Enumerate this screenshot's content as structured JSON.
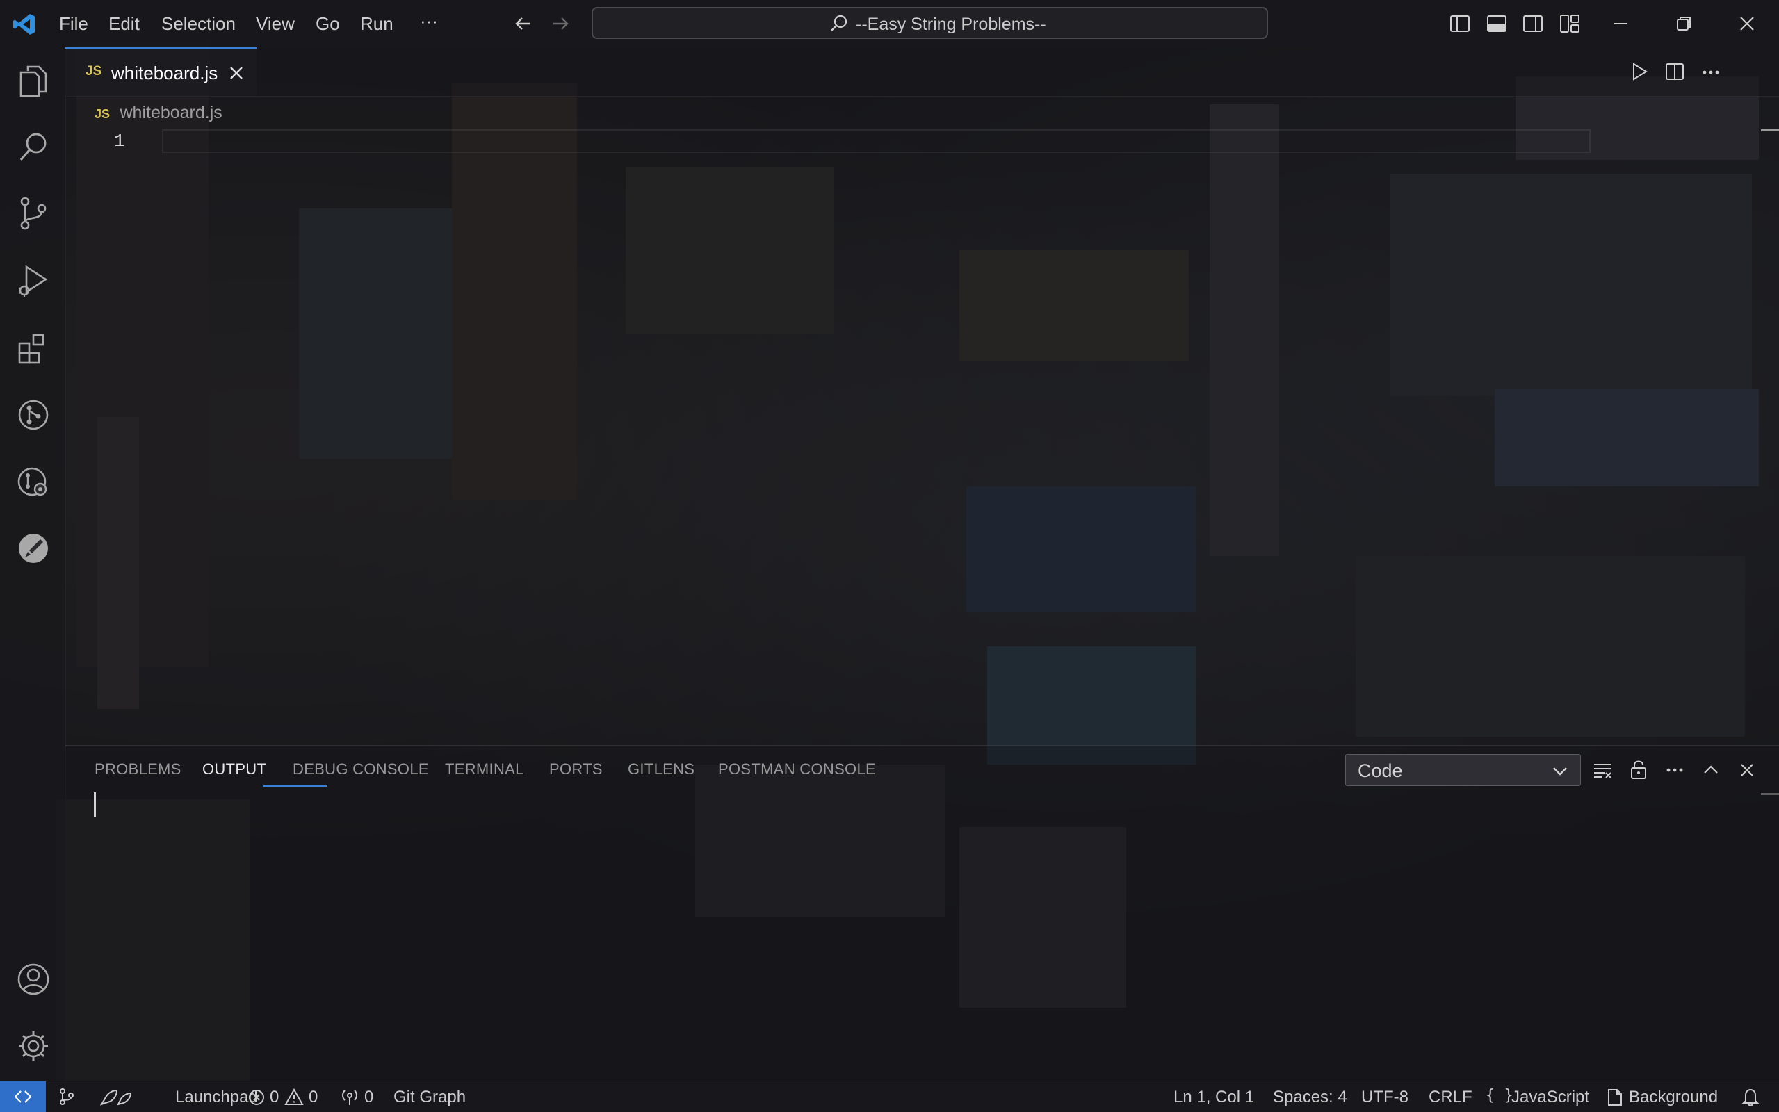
{
  "titlebar": {
    "menu": [
      "File",
      "Edit",
      "Selection",
      "View",
      "Go",
      "Run",
      "···"
    ],
    "search_text": "--Easy String Problems--"
  },
  "editor": {
    "tab_badge": "JS",
    "tab_label": "whiteboard.js",
    "breadcrumb_badge": "JS",
    "breadcrumb_file": "whiteboard.js",
    "line_numbers": [
      "1"
    ]
  },
  "panel": {
    "tabs": [
      "PROBLEMS",
      "OUTPUT",
      "DEBUG CONSOLE",
      "TERMINAL",
      "PORTS",
      "GITLENS",
      "POSTMAN CONSOLE"
    ],
    "active_tab": "OUTPUT",
    "dropdown_value": "Code"
  },
  "statusbar": {
    "launchpad": "Launchpad",
    "errors": "0",
    "warnings": "0",
    "ports": "0",
    "git_graph": "Git Graph",
    "position": "Ln 1, Col 1",
    "spaces": "Spaces: 4",
    "encoding": "UTF-8",
    "eol": "CRLF",
    "language": "JavaScript",
    "background": "Background"
  },
  "colors": {
    "accent": "#3b7fd8",
    "vscode_logo": "#2f8fe0",
    "js_badge": "#d8c455",
    "remote_indicator": "#2f6fc9"
  }
}
